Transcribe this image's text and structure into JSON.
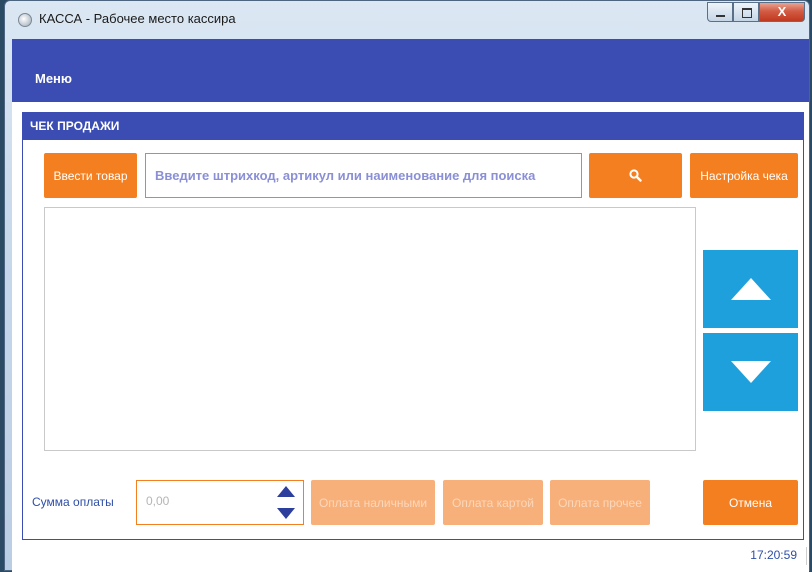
{
  "window": {
    "title": "КАССА - Рабочее место кассира",
    "close_glyph": "X"
  },
  "menu": {
    "label": "Меню"
  },
  "receipt": {
    "header": "ЧЕК ПРОДАЖИ",
    "enter_item_label": "Ввести товар",
    "search_placeholder": "Введите штрихкод, артикул или наименование для поиска",
    "search_icon": "search-icon",
    "receipt_settings_label": "Настройка чека"
  },
  "payment": {
    "sum_label": "Сумма оплаты",
    "sum_value": "0,00",
    "cash_label": "Оплата наличными",
    "card_label": "Оплата картой",
    "other_label": "Оплата прочее",
    "cancel_label": "Отмена"
  },
  "status": {
    "time": "17:20:59"
  },
  "colors": {
    "accent_blue": "#3b4db3",
    "orange": "#f47f20",
    "cyan": "#1ea0dc"
  }
}
